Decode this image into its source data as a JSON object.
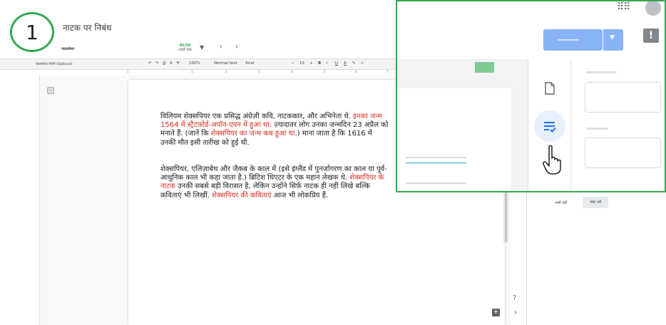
{
  "step_number": "1",
  "doc": {
    "title": "नाटक पर निबंध",
    "subtitle": "पाठकरेशर",
    "score": "45/50",
    "score_label": "अपूर्ण देख",
    "toolbar_left": "शेक्सपीयर रोचेनी (Optional)",
    "zoom": "100%",
    "style": "Normal text",
    "font": "Arial",
    "font_size": "15",
    "ruler_numbers": [
      "1",
      "1",
      "2",
      "3",
      "4",
      "5",
      "6",
      "7"
    ]
  },
  "paragraph1": {
    "part1": "विलियम शेक्सपियर एक प्रसिद्ध अंग्रेज़ी कवि, नाटककार, और अभिनेता थे. ",
    "highlight1": "इनका जन्म 1564 में स्ट्रैटफ़ोर्ड-अपॉन-एवन में हुआ था.",
    "part2": " ज़्यादातर लोग उनका जन्मदिन 23 अप्रैल को मनाते हैं. (जानें कि ",
    "highlight2": "शेक्सपियर का जन्म कब हुआ था",
    "part3": ".) माना जाता है कि 1616 में उनकी मौत इसी तारीख को हुई थी."
  },
  "paragraph2": {
    "part1": "शेक्सपियर, एलिज़ाबेथ और जैकब के काल में (इसे इंग्लैंड में पुनर्जागरण का काल या पूर्व-आधुनिक काल भी कहा जाता है.) ब्रिटिश थिएटर के एक महान लेखक थे. ",
    "highlight1": "शेक्सपियर के नाटक",
    "part2": " उनकी सबसे बड़ी विरासत है, लेकिन उन्होंने सिर्फ़ नाटक ही नहीं लिखे बल्कि कविताएं भी लिखीं. ",
    "highlight2": "शेक्सपियर की कविताएं",
    "part3": " आज भी लोकप्रिय हैं."
  },
  "side_panel": {
    "later_label": "अभी नहीं",
    "submit_label": "पोस्ट करें"
  },
  "icons": {
    "outline": "outline-icon",
    "help": "help-icon",
    "add": "add-icon",
    "chevron": "chevron-right-icon",
    "apps": "apps-grid-icon",
    "report": "report-icon",
    "file": "file-icon",
    "rubric": "rubric-icon",
    "cursor": "hand-pointer-icon"
  },
  "colors": {
    "accent_green": "#34a853",
    "highlight_red": "#d93025",
    "button_blue": "#8ab4f8"
  }
}
